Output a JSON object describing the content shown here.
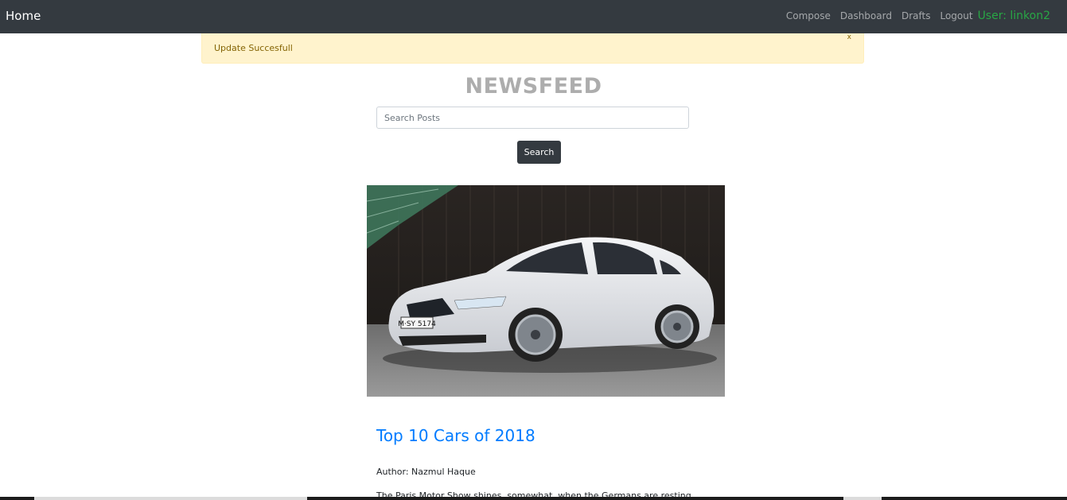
{
  "navbar": {
    "brand": "Home",
    "links": [
      "Compose",
      "Dashboard",
      "Drafts",
      "Logout"
    ],
    "user": "User: linkon2"
  },
  "alert": {
    "message": "Update Succesfull",
    "close": "x",
    "color": "#fff3cd"
  },
  "page": {
    "title": "NEWSFEED"
  },
  "search": {
    "placeholder": "Search Posts",
    "button_label": "Search"
  },
  "post": {
    "image_icon": "car-photo",
    "plate": "M·SY 5174",
    "title": "Top 10 Cars of 2018",
    "author": "Author: Nazmul Haque",
    "excerpt": "The Paris Motor Show shines, somewhat, when the Germans are resting"
  },
  "colors": {
    "navbar": "#343a40",
    "link": "#007bff",
    "user": "#28a745"
  }
}
